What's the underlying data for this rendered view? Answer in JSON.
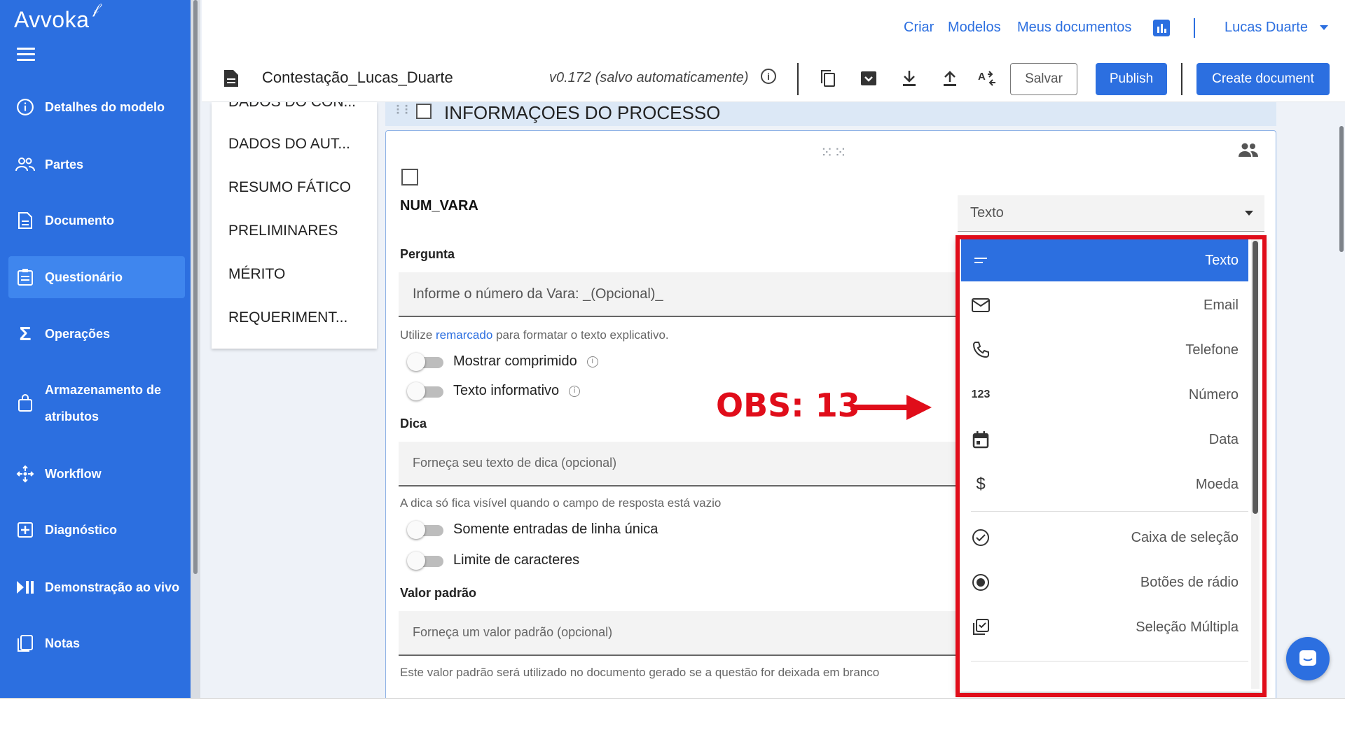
{
  "app": {
    "brand": "Avvoka"
  },
  "sidebar": {
    "items": [
      {
        "label": "Detalhes do modelo",
        "icon": "info-icon"
      },
      {
        "label": "Partes",
        "icon": "people-icon"
      },
      {
        "label": "Documento",
        "icon": "document-icon"
      },
      {
        "label": "Questionário",
        "icon": "clipboard-icon",
        "active": true
      },
      {
        "label": "Operações",
        "icon": "sigma-icon"
      },
      {
        "label_line1": "Armazenamento de",
        "label_line2": "atributos",
        "icon": "bag-icon"
      },
      {
        "label": "Workflow",
        "icon": "workflow-icon"
      },
      {
        "label": "Diagnóstico",
        "icon": "plus-box-icon"
      },
      {
        "label": "Demonstração ao vivo",
        "icon": "play-pause-icon"
      },
      {
        "label": "Notas",
        "icon": "notes-icon"
      }
    ]
  },
  "topbar": {
    "links": {
      "criar": "Criar",
      "modelos": "Modelos",
      "meus_documentos": "Meus documentos"
    },
    "user": "Lucas Duarte"
  },
  "toolbar": {
    "doc_title": "Contestação_Lucas_Duarte",
    "version": "v0.172 (salvo automaticamente)",
    "salvar": "Salvar",
    "publish": "Publish",
    "create_document": "Create document"
  },
  "sections": {
    "items": [
      "DADOS DO CON...",
      "DADOS DO AUT...",
      "RESUMO FÁTICO",
      "PRELIMINARES",
      "MÉRITO",
      "REQUERIMENT..."
    ],
    "current_title": "INFORMAÇOES DO PROCESSO"
  },
  "question": {
    "var_name": "NUM_VARA",
    "type_value": "Texto",
    "pergunta_label": "Pergunta",
    "pergunta_value": "Informe o número da Vara:  _(Opcional)_",
    "pergunta_helper_pre": "Utilize ",
    "pergunta_helper_link": "remarcado",
    "pergunta_helper_post": " para formatar o texto explicativo.",
    "toggle_mostrar": "Mostrar comprimido",
    "toggle_texto": "Texto informativo",
    "dica_label": "Dica",
    "dica_placeholder": "Forneça seu texto de dica (opcional)",
    "dica_helper": "A dica só fica visível quando o campo de resposta está vazio",
    "toggle_linha": "Somente entradas de linha única",
    "toggle_limite": "Limite de caracteres",
    "valor_label": "Valor padrão",
    "valor_placeholder": "Forneça um valor padrão (opcional)",
    "valor_helper": "Este valor padrão será utilizado no documento gerado se a questão for deixada em branco"
  },
  "type_menu": {
    "options": [
      {
        "label": "Texto",
        "icon": "text-lines-icon",
        "selected": true
      },
      {
        "label": "Email",
        "icon": "envelope-icon"
      },
      {
        "label": "Telefone",
        "icon": "phone-icon"
      },
      {
        "label": "Número",
        "icon": "numeric-123-icon",
        "glyph": "123"
      },
      {
        "label": "Data",
        "icon": "calendar-icon"
      },
      {
        "label": "Moeda",
        "icon": "dollar-icon",
        "glyph": "$"
      },
      {
        "label": "Caixa de seleção",
        "icon": "check-circle-icon"
      },
      {
        "label": "Botões de rádio",
        "icon": "radio-icon"
      },
      {
        "label": "Seleção Múltipla",
        "icon": "multi-check-icon"
      }
    ]
  },
  "annotation": {
    "text": "OBS: 13",
    "color": "#e00d1a"
  },
  "colors": {
    "primary": "#2c6fe0",
    "sidebar": "#2c6fe0",
    "annotation_red": "#e00d1a"
  }
}
